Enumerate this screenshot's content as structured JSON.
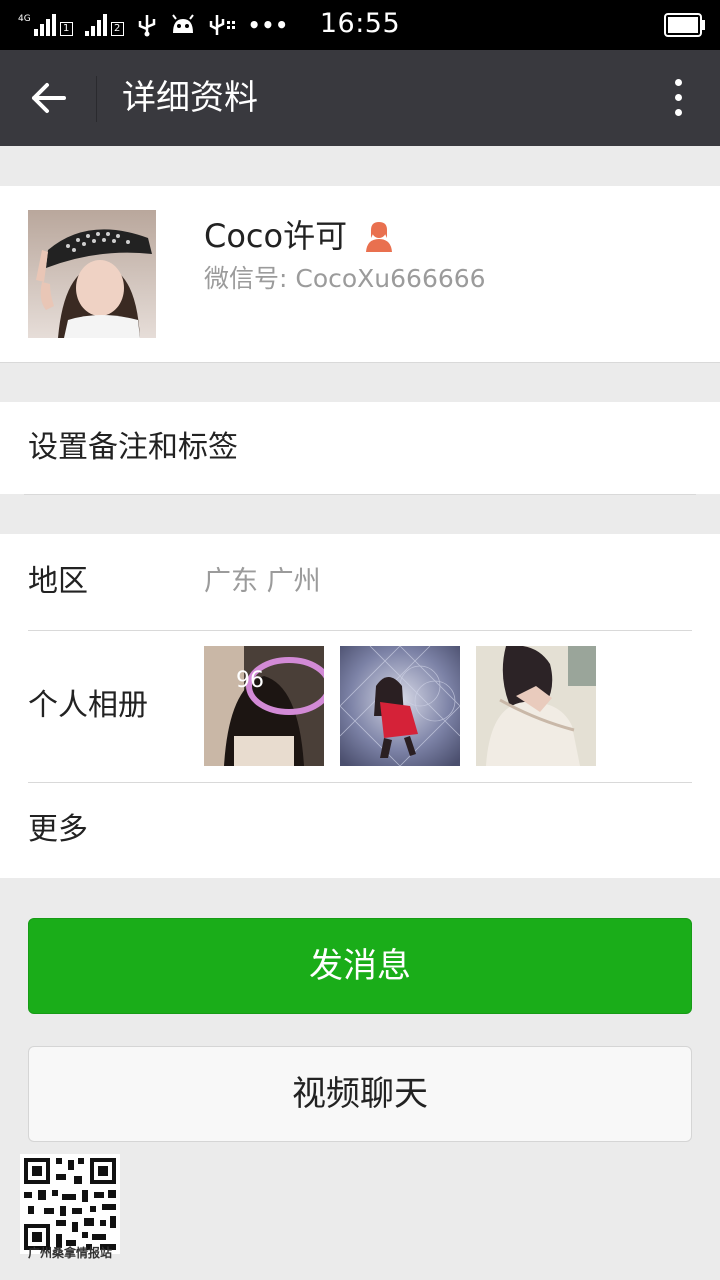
{
  "status_bar": {
    "network_tag": "4G",
    "sim1": "1",
    "sim2": "2",
    "dots": "•••",
    "time": "16:55"
  },
  "header": {
    "title": "详细资料",
    "back_icon": "back-arrow-icon",
    "more_icon": "more-vertical-icon"
  },
  "profile": {
    "name": "Coco许可",
    "gender_icon": "female-icon",
    "gender_color": "#e9704f",
    "wechat_id_label": "微信号: ",
    "wechat_id": "CocoXu666666"
  },
  "remark": {
    "label": "设置备注和标签"
  },
  "info": {
    "region_label": "地区",
    "region_value": "广东  广州",
    "album_label": "个人相册",
    "album_photo1_text": "96",
    "more_label": "更多"
  },
  "actions": {
    "send_message": "发消息",
    "video_call": "视频聊天",
    "accent_color": "#1aad19"
  },
  "watermark": {
    "caption": "广州桑拿情报站"
  }
}
